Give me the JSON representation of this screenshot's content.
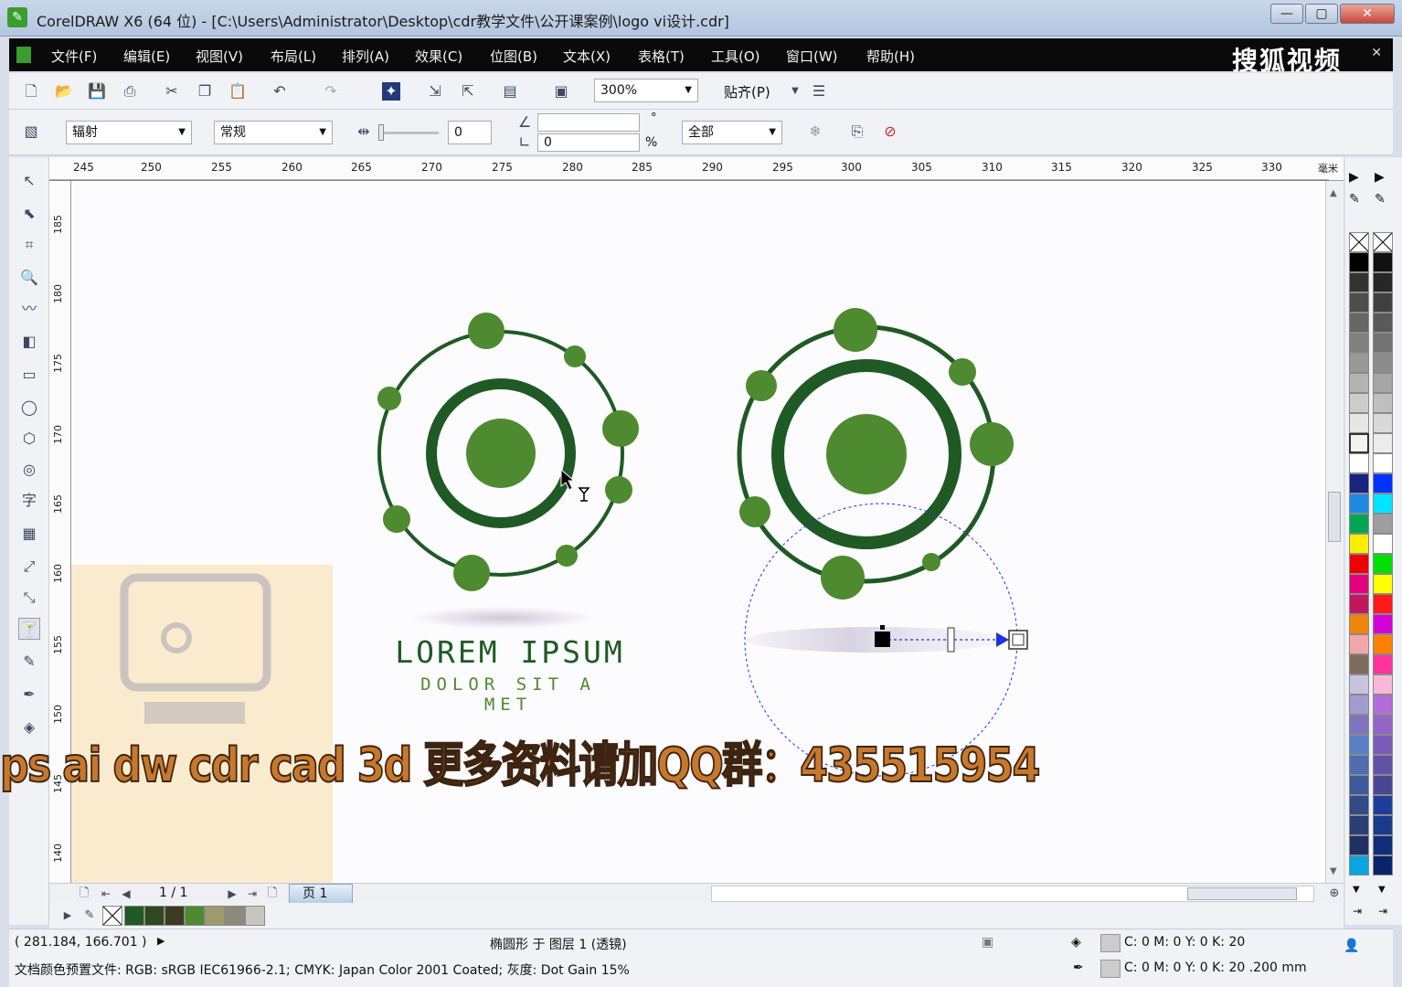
{
  "window": {
    "title": "CorelDRAW X6 (64 位) - [C:\\Users\\Administrator\\Desktop\\cdr教学文件\\公开课案例\\logo vi设计.cdr]",
    "controls": [
      "—",
      "▢",
      "✕"
    ]
  },
  "menu": {
    "items": [
      "文件(F)",
      "编辑(E)",
      "视图(V)",
      "布局(L)",
      "排列(A)",
      "效果(C)",
      "位图(B)",
      "文本(X)",
      "表格(T)",
      "工具(O)",
      "窗口(W)",
      "帮助(H)"
    ],
    "overlay_brand": "搜狐视频"
  },
  "toolbar": {
    "zoom": "300%",
    "snap_label": "贴齐(P)"
  },
  "property_bar": {
    "transparency_type": "辐射",
    "merge_mode": "常规",
    "midpoint_value": "0",
    "angle_value": "",
    "border_value": "0",
    "percent_label": "%",
    "degree_label": "°",
    "apply_to": "全部"
  },
  "rulers": {
    "unit": "毫米",
    "horizontal_ticks": [
      "245",
      "250",
      "255",
      "260",
      "265",
      "270",
      "275",
      "280",
      "285",
      "290",
      "295",
      "300",
      "305",
      "310",
      "315",
      "320",
      "325",
      "330"
    ],
    "vertical_ticks": [
      "185",
      "180",
      "175",
      "170",
      "165",
      "160",
      "155",
      "150",
      "145",
      "140"
    ]
  },
  "artwork": {
    "logo_title": "LOREM IPSUM",
    "logo_subtitle": "DOLOR SIT A MET",
    "colors": {
      "dark_green": "#1f5a25",
      "light_green": "#4e8a30",
      "selection_blue": "#2233dd"
    }
  },
  "page_navigator": {
    "counter": "1 / 1",
    "page_tab": "页 1"
  },
  "status": {
    "coordinates": "( 281.184, 166.701 )",
    "selection_info": "椭圆形 于 图层 1 (透镜)",
    "fill_info": "C: 0 M: 0 Y: 0 K: 20",
    "outline_info": "C: 0 M: 0 Y: 0 K: 20  .200 mm",
    "color_profile": "文档颜色预置文件: RGB: sRGB IEC61966-2.1; CMYK: Japan Color 2001 Coated; 灰度: Dot Gain 15%"
  },
  "overlays": {
    "promo_text": "ps ai dw cdr cad 3d 更多资料请加QQ群：435515954"
  }
}
